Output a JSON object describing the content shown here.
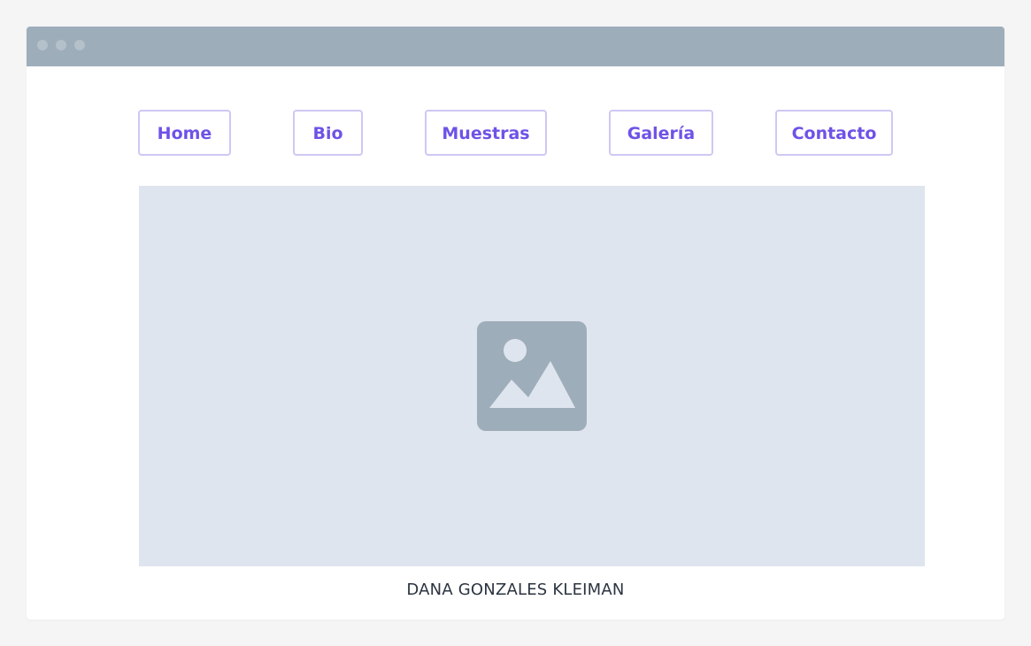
{
  "window": {
    "titlebar_dots": [
      "close-dot",
      "minimize-dot",
      "maximize-dot"
    ]
  },
  "nav": {
    "items": [
      {
        "label": "Home"
      },
      {
        "label": "Bio"
      },
      {
        "label": "Muestras"
      },
      {
        "label": "Galería"
      },
      {
        "label": "Contacto"
      }
    ]
  },
  "hero": {
    "icon": "image-placeholder-icon"
  },
  "footer": {
    "name": "DANA GONZALES KLEIMAN"
  },
  "colors": {
    "titlebar": "#9eadba",
    "accent": "#6f52e7",
    "button_border": "#cfc8f4",
    "placeholder_bg": "#dfe5ee",
    "icon": "#9eadba",
    "text": "#2b3440"
  }
}
